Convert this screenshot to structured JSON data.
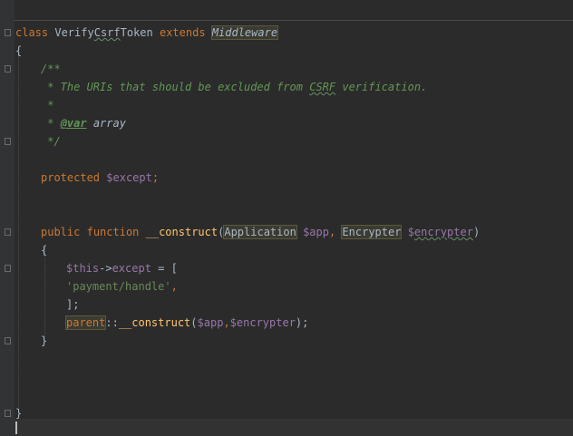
{
  "editor": {
    "top_fragment_left": ", ",
    "top_fragment_mid": "(",
    "top_fragment_right": "    ",
    "class_kw": "class",
    "class_name_a": "Verify",
    "class_name_typo": "Csrf",
    "class_name_b": "Token",
    "extends_kw": "extends",
    "parent_class": "Middleware",
    "open_brace": "{",
    "doc_open": "/**",
    "doc_desc_pre": " * The URIs that should be excluded from ",
    "doc_desc_typo": "CSRF",
    "doc_desc_post": " verification.",
    "doc_blank": " *",
    "doc_star": " * ",
    "doc_tag": "@var",
    "doc_type": " array",
    "doc_close": " */",
    "protected_kw": "protected",
    "except_prop": "$except",
    "semicolon": ";",
    "public_kw": "public",
    "function_kw": "function",
    "construct_name": "__construct",
    "paren_open": "(",
    "param1_type": "Application",
    "param1_var": "$app",
    "comma": ", ",
    "param2_type": "Encrypter",
    "param2_var_pre": "$",
    "param2_var_typo": "encrypter",
    "paren_close": ")",
    "method_open": "{",
    "this_var": "$this",
    "arrow": "->",
    "except_name": "except",
    "assign_open": " = [",
    "string_value": "'payment/handle'",
    "string_comma": ",",
    "array_close": "];",
    "parent_kw": "parent",
    "static_op": "::",
    "parent_call": "__construct",
    "call_args_open": "(",
    "arg_app": "$app",
    "arg_comma": ",",
    "arg_encrypter": "$encrypter",
    "call_close": ");",
    "method_close": "}",
    "class_close": "}"
  }
}
